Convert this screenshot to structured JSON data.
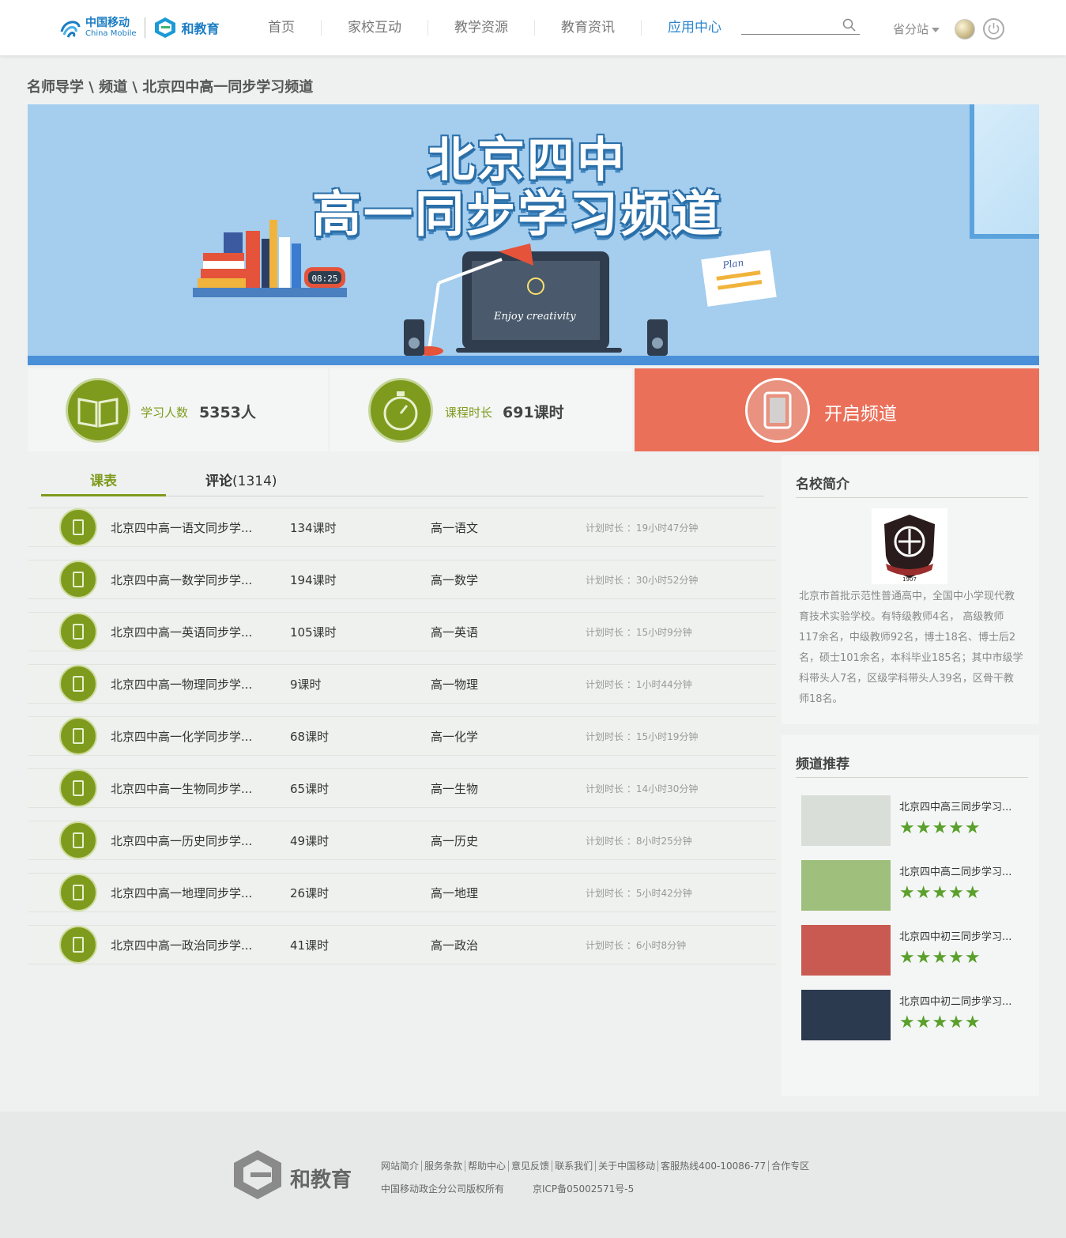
{
  "header": {
    "china_mobile_cn": "中国移动",
    "china_mobile_en": "China Mobile",
    "brand": "和教育",
    "nav": [
      "首页",
      "家校互动",
      "教学资源",
      "教育资讯",
      "应用中心"
    ],
    "active_nav": "应用中心",
    "search_value": "",
    "province": "省分站"
  },
  "breadcrumb": "名师导学 \\ 频道 \\ 北京四中高一同步学习频道",
  "banner": {
    "title_line1": "北京四中",
    "title_line2": "高一同步学习频道",
    "clock": "08:25"
  },
  "stats": {
    "learners_label": "学习人数",
    "learners_value": "5353人",
    "duration_label": "课程时长",
    "duration_value": "691课时",
    "open_button": "开启频道"
  },
  "tabs": {
    "schedule": "课表",
    "comments": "评论",
    "comments_count": "(1314)"
  },
  "courses": [
    {
      "name": "北京四中高一语文同步学...",
      "hours": "134课时",
      "subject": "高一语文",
      "plan": "计划时长 ：19小时47分钟"
    },
    {
      "name": "北京四中高一数学同步学...",
      "hours": "194课时",
      "subject": "高一数学",
      "plan": "计划时长 ：30小时52分钟"
    },
    {
      "name": "北京四中高一英语同步学...",
      "hours": "105课时",
      "subject": "高一英语",
      "plan": "计划时长 ：15小时9分钟"
    },
    {
      "name": "北京四中高一物理同步学...",
      "hours": "9课时",
      "subject": "高一物理",
      "plan": "计划时长 ：1小时44分钟"
    },
    {
      "name": "北京四中高一化学同步学...",
      "hours": "68课时",
      "subject": "高一化学",
      "plan": "计划时长 ：15小时19分钟"
    },
    {
      "name": "北京四中高一生物同步学...",
      "hours": "65课时",
      "subject": "高一生物",
      "plan": "计划时长 ：14小时30分钟"
    },
    {
      "name": "北京四中高一历史同步学...",
      "hours": "49课时",
      "subject": "高一历史",
      "plan": "计划时长 ：8小时25分钟"
    },
    {
      "name": "北京四中高一地理同步学...",
      "hours": "26课时",
      "subject": "高一地理",
      "plan": "计划时长 ：5小时42分钟"
    },
    {
      "name": "北京四中高一政治同步学...",
      "hours": "41课时",
      "subject": "高一政治",
      "plan": "计划时长 ：6小时8分钟"
    }
  ],
  "school": {
    "title": "名校简介",
    "emblem_year": "1907",
    "description": "北京市首批示范性普通高中，全国中小学现代教育技术实验学校。有特级教师4名， 高级教师117余名，中级教师92名，博士18名、博士后2名，硕士101余名，本科毕业185名；其中市级学科带头人7名，区级学科带头人39名，区骨干教师18名。"
  },
  "recommend": {
    "title": "频道推荐",
    "items": [
      {
        "name": "北京四中高三同步学习...",
        "rating": 5,
        "thumb_color": "#d9ded8"
      },
      {
        "name": "北京四中高二同步学习...",
        "rating": 5,
        "thumb_color": "#9fbf7c"
      },
      {
        "name": "北京四中初三同步学习...",
        "rating": 5,
        "thumb_color": "#c95a52"
      },
      {
        "name": "北京四中初二同步学习...",
        "rating": 5,
        "thumb_color": "#2b3a4f"
      }
    ]
  },
  "footer": {
    "brand": "和教育",
    "links": [
      "网站简介",
      "服务条款",
      "帮助中心",
      "意见反馈",
      "联系我们",
      "关于中国移动",
      "客服热线400-10086-77",
      "合作专区"
    ],
    "copyright": "中国移动政企分公司版权所有",
    "icp": "京ICP备05002571号-5"
  },
  "colors": {
    "accent_green": "#7e9b1d",
    "open_button": "#eb705a",
    "nav_active": "#2a86d0",
    "star": "#5aa02c"
  }
}
